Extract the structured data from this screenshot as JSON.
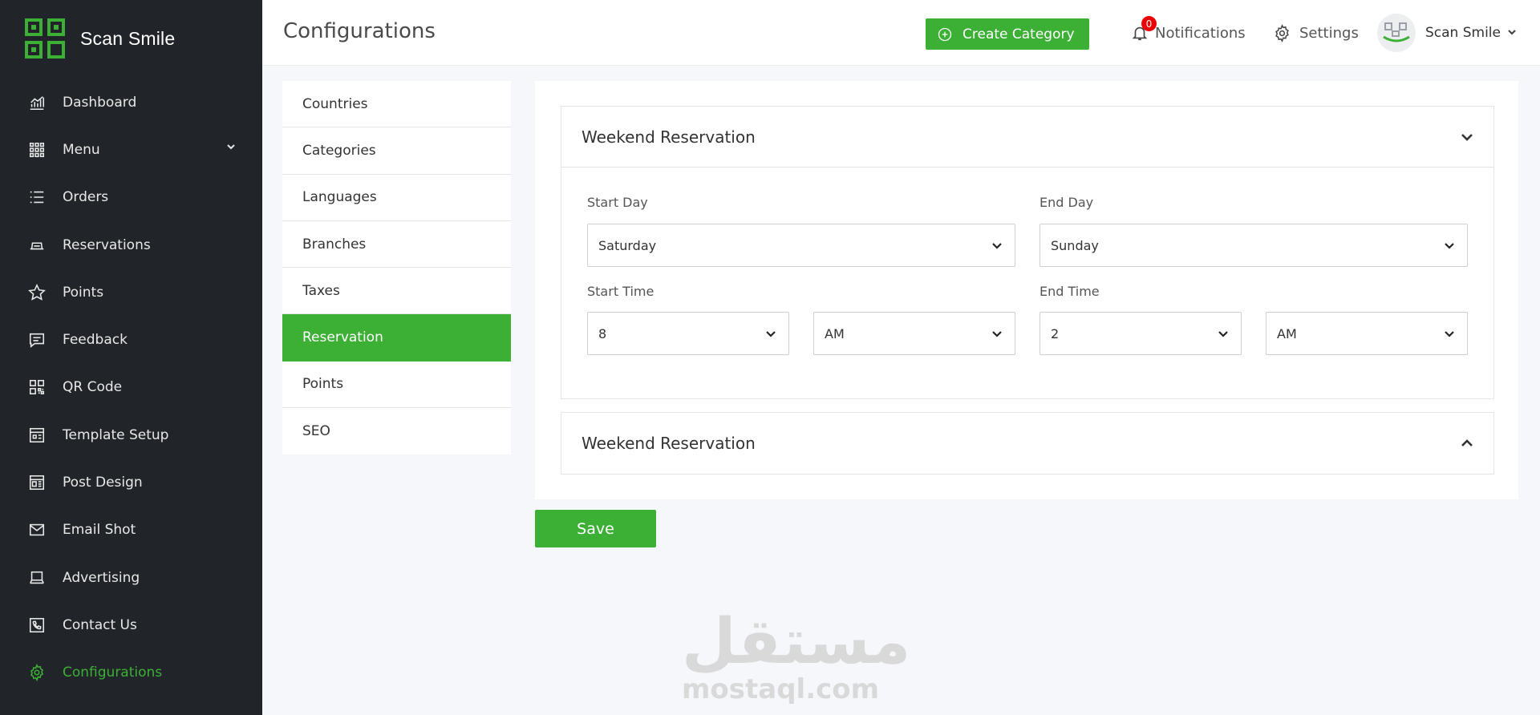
{
  "brand": {
    "name": "Scan Smile"
  },
  "sidebar": {
    "items": [
      {
        "label": "Dashboard",
        "icon": "chart-icon"
      },
      {
        "label": "Menu",
        "icon": "grid-icon",
        "has_children": true
      },
      {
        "label": "Orders",
        "icon": "list-icon"
      },
      {
        "label": "Reservations",
        "icon": "reservation-icon"
      },
      {
        "label": "Points",
        "icon": "star-icon"
      },
      {
        "label": "Feedback",
        "icon": "feedback-icon"
      },
      {
        "label": "QR Code",
        "icon": "qr-icon"
      },
      {
        "label": "Template Setup",
        "icon": "template-icon"
      },
      {
        "label": "Post Design",
        "icon": "post-icon"
      },
      {
        "label": "Email Shot",
        "icon": "mail-icon"
      },
      {
        "label": "Advertising",
        "icon": "laptop-icon"
      },
      {
        "label": "Contact Us",
        "icon": "phone-icon"
      },
      {
        "label": "Configurations",
        "icon": "gear-icon",
        "active": true
      }
    ]
  },
  "header": {
    "title": "Configurations",
    "create_label": "Create Category",
    "notifications_label": "Notifications",
    "notifications_count": "0",
    "settings_label": "Settings",
    "user_name": "Scan Smile"
  },
  "config_menu": {
    "items": [
      "Countries",
      "Categories",
      "Languages",
      "Branches",
      "Taxes",
      "Reservation",
      "Points",
      "SEO"
    ],
    "active": "Reservation"
  },
  "accordion": [
    {
      "title": "Weekend Reservation",
      "expanded": true,
      "start_day_label": "Start Day",
      "start_day": "Saturday",
      "end_day_label": "End Day",
      "end_day": "Sunday",
      "start_time_label": "Start Time",
      "start_hour": "8",
      "start_period": "AM",
      "end_time_label": "End Time",
      "end_hour": "2",
      "end_period": "AM"
    },
    {
      "title": "Weekend Reservation",
      "expanded": false
    }
  ],
  "save_label": "Save",
  "watermark": {
    "arabic": "مستقل",
    "latin": "mostaql.com"
  },
  "colors": {
    "accent": "#3cb035",
    "sidebar_bg": "#212529",
    "badge": "#ee0000"
  }
}
